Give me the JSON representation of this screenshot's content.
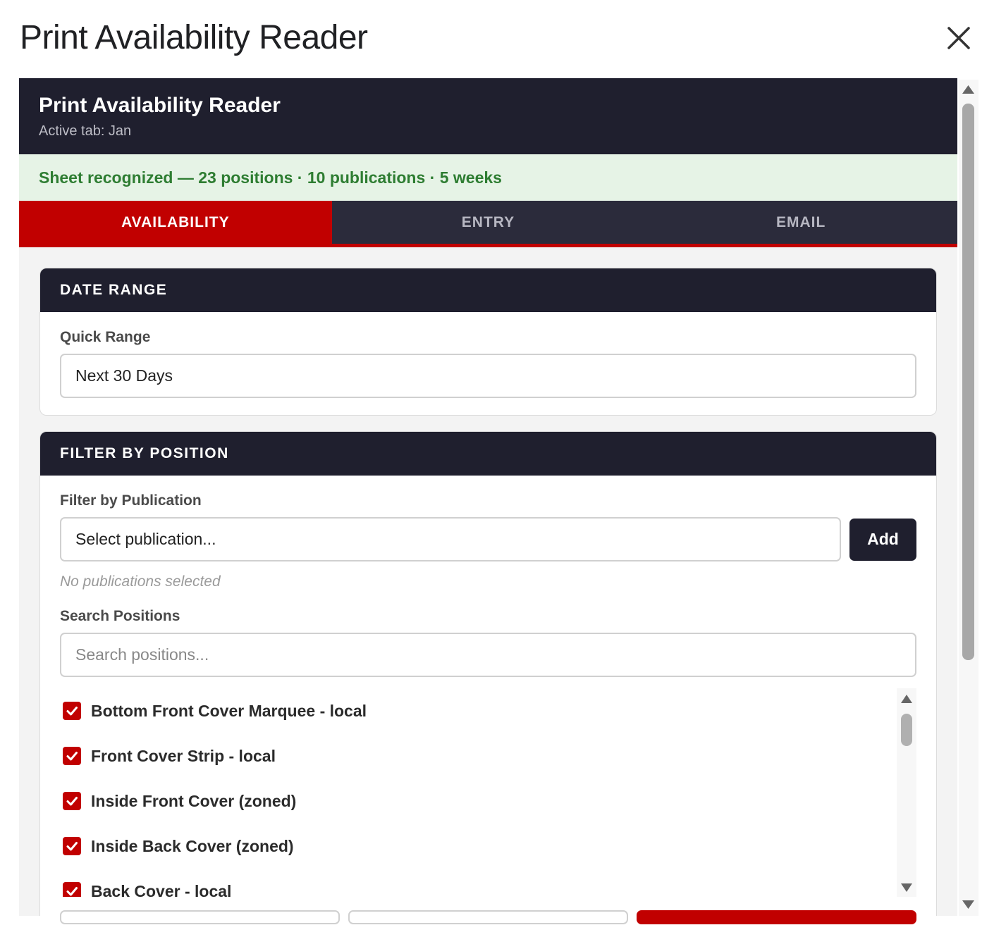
{
  "dialog": {
    "title": "Print Availability Reader"
  },
  "header": {
    "title": "Print Availability Reader",
    "subtitle": "Active tab: Jan"
  },
  "status": {
    "text": "Sheet recognized — 23 positions · 10 publications · 5 weeks"
  },
  "tabs": [
    {
      "label": "AVAILABILITY"
    },
    {
      "label": "ENTRY"
    },
    {
      "label": "EMAIL"
    }
  ],
  "date_range": {
    "heading": "DATE RANGE",
    "quick_range_label": "Quick Range",
    "quick_range_value": "Next 30 Days"
  },
  "filter": {
    "heading": "FILTER BY POSITION",
    "publication_label": "Filter by Publication",
    "publication_placeholder": "Select publication...",
    "add_label": "Add",
    "no_selection_hint": "No publications selected",
    "search_label": "Search Positions",
    "search_placeholder": "Search positions...",
    "positions": [
      {
        "label": "Bottom Front Cover Marquee - local",
        "checked": true
      },
      {
        "label": "Front Cover Strip - local",
        "checked": true
      },
      {
        "label": "Inside Front Cover (zoned)",
        "checked": true
      },
      {
        "label": "Inside Back Cover (zoned)",
        "checked": true
      },
      {
        "label": "Back Cover - local",
        "checked": true
      }
    ]
  },
  "colors": {
    "accent": "#c10000",
    "dark": "#1f1f2e",
    "success": "#2e7d32",
    "success_bg": "#e6f3e6"
  }
}
